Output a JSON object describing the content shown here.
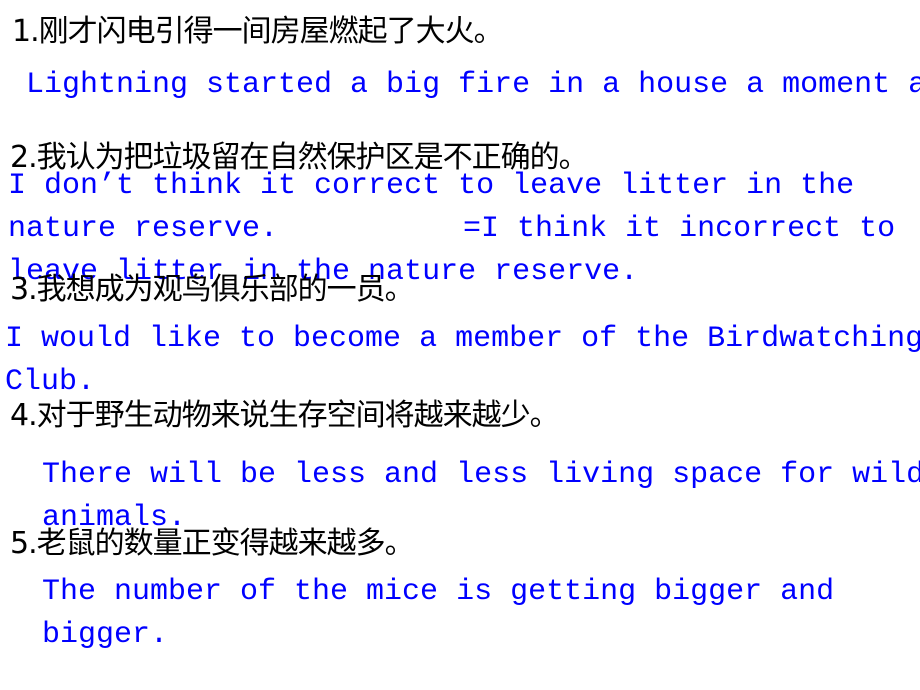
{
  "items": [
    {
      "number": "1.",
      "chinese": "刚才闪电引得一间房屋燃起了大火。",
      "english_lines": [
        "Lightning started a big fire in a house a moment a"
      ]
    },
    {
      "number": "2.",
      "chinese": "我认为把垃圾留在自然保护区是不正确的。",
      "english_lines": [
        "I don’t think it correct to leave litter in the",
        "nature reserve.       =I think it incorrect to",
        "leave litter in the nature reserve."
      ]
    },
    {
      "number": "3.",
      "chinese": "我想成为观鸟俱乐部的一员。",
      "english_lines": [
        "I would like to become a member of the Birdwatching",
        "Club."
      ]
    },
    {
      "number": "4.",
      "chinese": "对于野生动物来说生存空间将越来越少。",
      "english_lines": [
        "There will be less and less living space for wild",
        "animals."
      ]
    },
    {
      "number": "5.",
      "chinese": "老鼠的数量正变得越来越多。",
      "english_lines": [
        "The number of the mice is getting bigger and",
        "bigger."
      ]
    }
  ],
  "colors": {
    "chinese_text": "#000000",
    "english_text": "#0000ff",
    "background": "#ffffff"
  }
}
